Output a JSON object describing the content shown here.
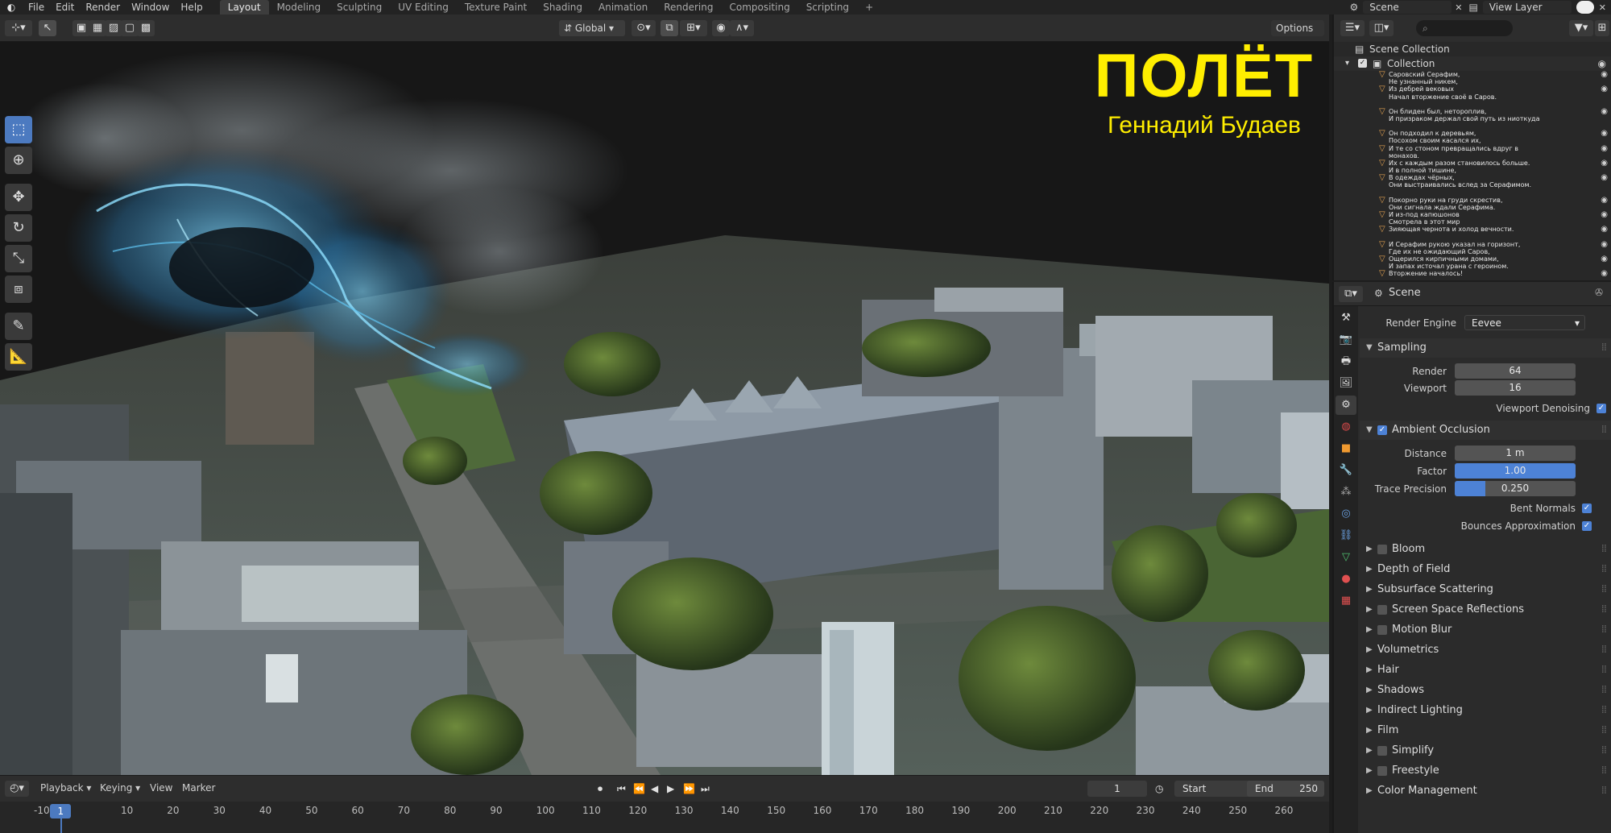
{
  "topbar": {
    "menus": [
      "File",
      "Edit",
      "Render",
      "Window",
      "Help"
    ],
    "workspaces": [
      "Layout",
      "Modeling",
      "Sculpting",
      "UV Editing",
      "Texture Paint",
      "Shading",
      "Animation",
      "Rendering",
      "Compositing",
      "Scripting"
    ],
    "active_workspace": "Layout",
    "add_tab": "+",
    "scene_name": "Scene",
    "view_layer": "View Layer"
  },
  "viewport_header": {
    "orientation": "Global",
    "options": "Options"
  },
  "overlay": {
    "title": "ПОЛЁТ",
    "author": "Геннадий Будаев"
  },
  "outliner": {
    "root": "Scene Collection",
    "collection": "Collection",
    "verses": [
      [
        "Саровский Серафим,",
        "Не узнанный никем,",
        "Из дебрей вековых",
        "Начал вторжение своё в Саров."
      ],
      [
        "Он блиден был, нетороплив,",
        "И призраком держал свой путь из ниоткуда"
      ],
      [
        "Он подходил к деревьям,",
        "Посохом своим касался их,",
        "И те со стоном превращались вдруг в монахов."
      ],
      [
        "Их с каждым разом становилось больше.",
        "И в полной тишине,",
        "В одеждах чёрных,",
        "Они выстраивались вслед за Серафимом."
      ],
      [
        "Покорно руки на груди скрестив,",
        "Они сигнала ждали Серафима.",
        "И из-под капюшонов",
        "Смотрела в этот мир",
        "Зияющая чернота и холод вечности."
      ],
      [
        "И Серафим рукою указал на горизонт,",
        "Где их не ожидающий Саров,",
        "Ощерился кирпичными домами,",
        "И запах источал урана с героином.",
        "Вторжение началось!"
      ]
    ]
  },
  "properties": {
    "context": "Scene",
    "render_engine_label": "Render Engine",
    "render_engine": "Eevee",
    "sampling": {
      "title": "Sampling",
      "render_label": "Render",
      "render": "64",
      "viewport_label": "Viewport",
      "viewport": "16",
      "denoise_label": "Viewport Denoising"
    },
    "ao": {
      "title": "Ambient Occlusion",
      "distance_label": "Distance",
      "distance": "1 m",
      "factor_label": "Factor",
      "factor": "1.00",
      "factor_fill": 1.0,
      "trace_label": "Trace Precision",
      "trace": "0.250",
      "trace_fill": 0.25,
      "bent_label": "Bent Normals",
      "bounces_label": "Bounces Approximation"
    },
    "sections": [
      {
        "label": "Bloom",
        "checkbox": true
      },
      {
        "label": "Depth of Field",
        "checkbox": false
      },
      {
        "label": "Subsurface Scattering",
        "checkbox": false
      },
      {
        "label": "Screen Space Reflections",
        "checkbox": true
      },
      {
        "label": "Motion Blur",
        "checkbox": true
      },
      {
        "label": "Volumetrics",
        "checkbox": false
      },
      {
        "label": "Hair",
        "checkbox": false
      },
      {
        "label": "Shadows",
        "checkbox": false
      },
      {
        "label": "Indirect Lighting",
        "checkbox": false
      },
      {
        "label": "Film",
        "checkbox": false
      },
      {
        "label": "Simplify",
        "checkbox": true
      },
      {
        "label": "Freestyle",
        "checkbox": true
      },
      {
        "label": "Color Management",
        "checkbox": false
      }
    ]
  },
  "timeline": {
    "menus": [
      "Playback",
      "Keying",
      "View",
      "Marker"
    ],
    "current_frame": "1",
    "start_label": "Start",
    "start": "1",
    "end_label": "End",
    "end": "250",
    "ticks": [
      "-10",
      "1",
      "10",
      "20",
      "30",
      "40",
      "50",
      "60",
      "70",
      "80",
      "90",
      "100",
      "110",
      "120",
      "130",
      "140",
      "150",
      "160",
      "170",
      "180",
      "190",
      "200",
      "210",
      "220",
      "230",
      "240",
      "250",
      "260"
    ]
  },
  "colors": {
    "accent": "#4c7ac0",
    "title_yellow": "#ffee00",
    "smoke_cyan": "#58c8ff"
  }
}
